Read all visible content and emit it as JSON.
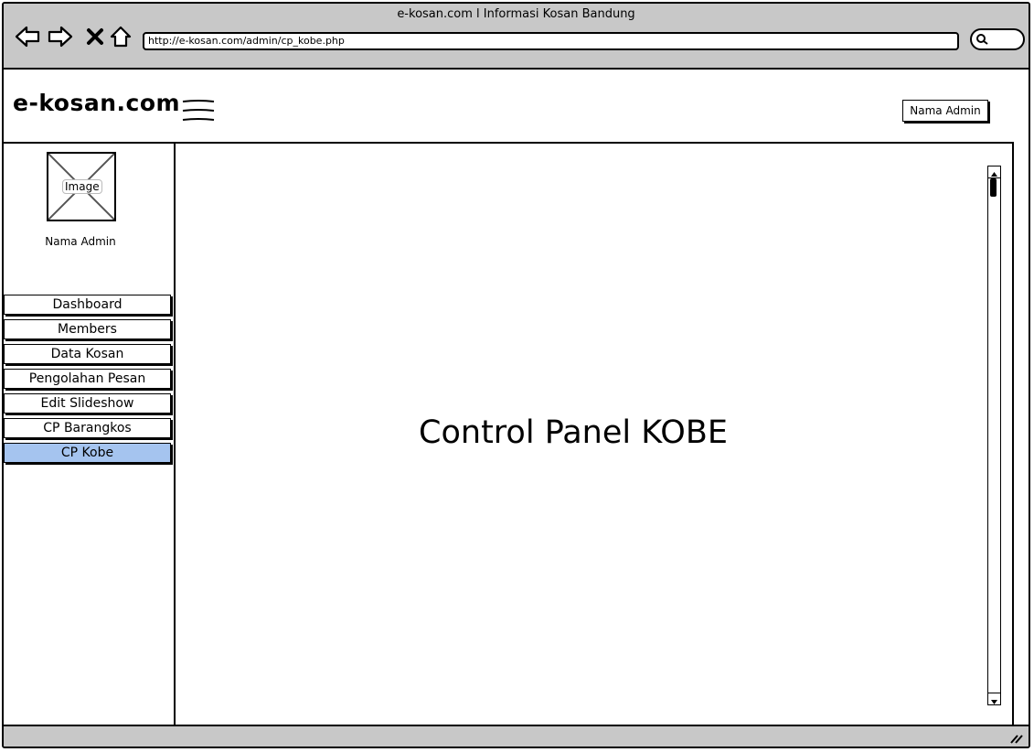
{
  "browser": {
    "window_title": "e-kosan.com l Informasi Kosan Bandung",
    "url": "http://e-kosan.com/admin/cp_kobe.php"
  },
  "header": {
    "logo": "e-kosan.com",
    "admin_button": "Nama Admin"
  },
  "sidebar": {
    "avatar_label": "Image",
    "admin_name": "Nama Admin",
    "items": [
      {
        "label": "Dashboard",
        "active": false
      },
      {
        "label": "Members",
        "active": false
      },
      {
        "label": "Data Kosan",
        "active": false
      },
      {
        "label": "Pengolahan Pesan",
        "active": false
      },
      {
        "label": "Edit Slideshow",
        "active": false
      },
      {
        "label": "CP Barangkos",
        "active": false
      },
      {
        "label": "CP Kobe",
        "active": true
      }
    ]
  },
  "main": {
    "title": "Control Panel KOBE"
  },
  "colors": {
    "chrome": "#c8c8c8",
    "active_item": "#a5c4ef"
  }
}
